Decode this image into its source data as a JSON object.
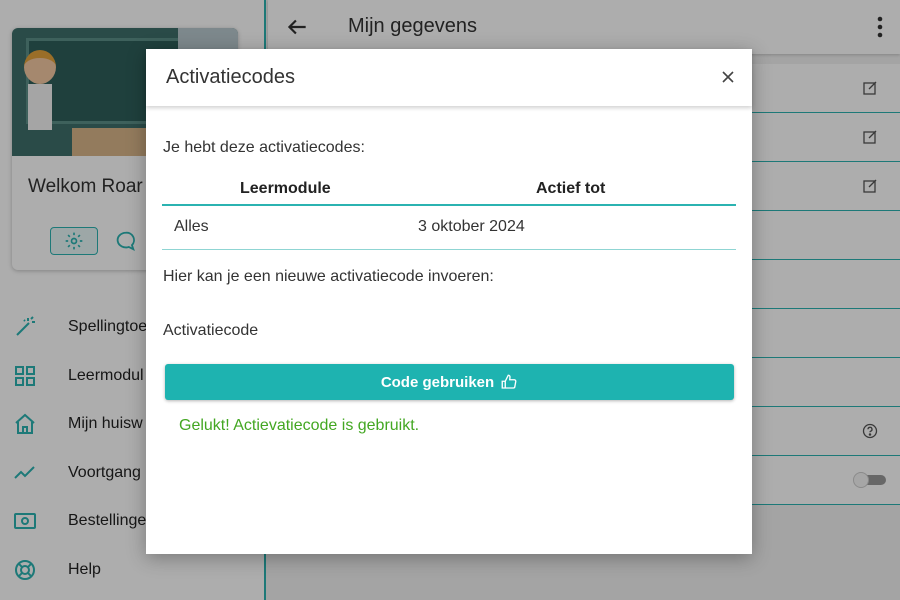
{
  "sidebar": {
    "welcome": "Welkom Roar",
    "nav": [
      {
        "label": "Spellingtoe",
        "icon": "magic-wand-icon"
      },
      {
        "label": "Leermodul",
        "icon": "grid-icon"
      },
      {
        "label": "Mijn huisw",
        "icon": "home-icon"
      },
      {
        "label": "Voortgang",
        "icon": "trend-icon"
      },
      {
        "label": "Bestellinge",
        "icon": "money-icon"
      },
      {
        "label": "Help",
        "icon": "lifebuoy-icon"
      }
    ]
  },
  "topbar": {
    "title": "Mijn gegevens"
  },
  "modal": {
    "title": "Activatiecodes",
    "intro": "Je hebt deze activatiecodes:",
    "table": {
      "headers": [
        "Leermodule",
        "Actief tot"
      ],
      "rows": [
        [
          "Alles",
          "3 oktober 2024"
        ]
      ]
    },
    "new_code_text": "Hier kan je een nieuwe activatiecode invoeren:",
    "field_label": "Activatiecode",
    "button_label": "Code gebruiken",
    "success_message": "Gelukt! Actievatiecode is gebruikt."
  },
  "colors": {
    "accent": "#1eb3b0",
    "success": "#43a722"
  }
}
